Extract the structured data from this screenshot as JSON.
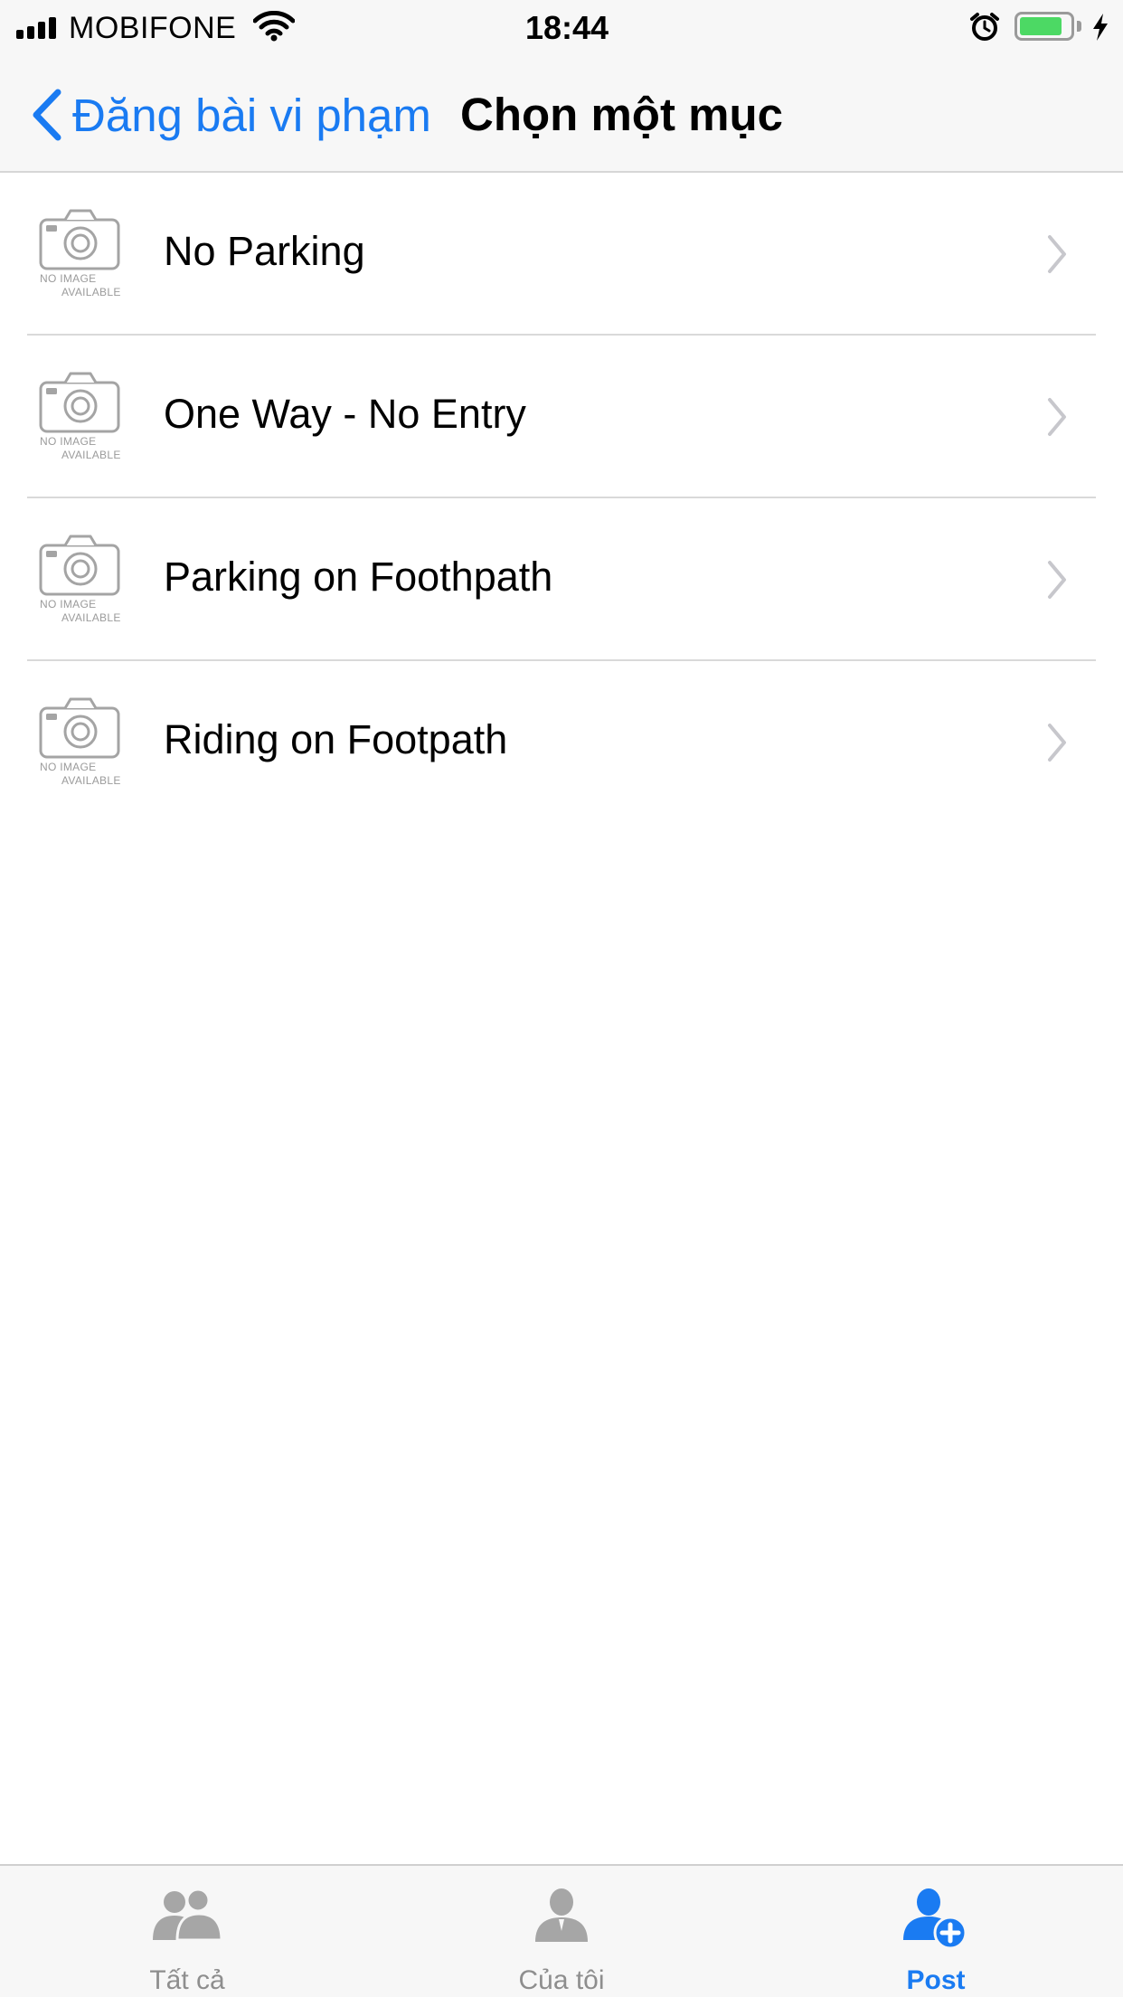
{
  "status_bar": {
    "carrier": "MOBIFONE",
    "time": "18:44",
    "battery_level": 0.85
  },
  "nav": {
    "back_label": "Đăng bài vi phạm",
    "title": "Chọn một mục"
  },
  "thumbnail": {
    "line1": "NO IMAGE",
    "line2": "AVAILABLE"
  },
  "items": [
    {
      "label": "No Parking"
    },
    {
      "label": "One Way - No Entry"
    },
    {
      "label": "Parking on Foothpath"
    },
    {
      "label": "Riding on Footpath"
    }
  ],
  "tabs": [
    {
      "label": "Tất cả",
      "icon": "group-icon",
      "active": false
    },
    {
      "label": "Của tôi",
      "icon": "user-icon",
      "active": false
    },
    {
      "label": "Post",
      "icon": "add-user-icon",
      "active": true
    }
  ],
  "colors": {
    "accent": "#1a7bf2",
    "inactive": "#8e8e8e",
    "battery": "#4cd964",
    "placeholder": "#9b9b9b"
  }
}
